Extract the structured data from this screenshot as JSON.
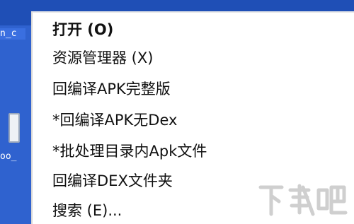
{
  "desktop": {
    "icon_label_1": "n_c",
    "icon_label_2": "oo_"
  },
  "context_menu": {
    "items": [
      {
        "label": "打开 (O)"
      },
      {
        "label": "资源管理器 (X)"
      },
      {
        "label": "回编译APK完整版"
      },
      {
        "label": "*回编译APK无Dex"
      },
      {
        "label": "*批处理目录内Apk文件"
      },
      {
        "label": "回编译DEX文件夹"
      },
      {
        "label": "搜索 (E)..."
      }
    ]
  },
  "watermark": {
    "text": "下载吧"
  }
}
